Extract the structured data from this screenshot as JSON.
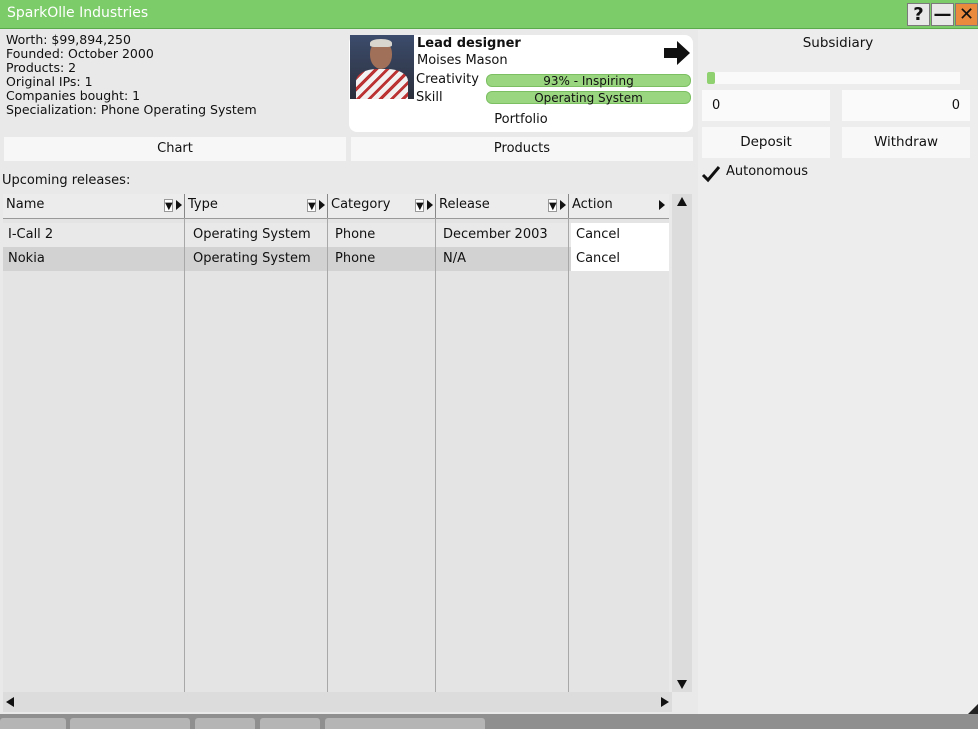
{
  "window": {
    "title": "SparkOlle Industries"
  },
  "titlebar": {
    "help_label": "?",
    "minimize_label": "—",
    "close_label": "✕"
  },
  "company": {
    "worth": "Worth: $99,894,250",
    "founded": "Founded: October 2000",
    "products": "Products: 2",
    "original_ips": "Original IPs: 1",
    "companies_bought": "Companies bought: 1",
    "specialization": "Specialization: Phone Operating System"
  },
  "designer": {
    "role": "Lead designer",
    "name": "Moises Mason",
    "creativity_label": "Creativity",
    "creativity_value": "93% - Inspiring",
    "creativity_fraction": 1.0,
    "skill_label": "Skill",
    "skill_value": "Operating System",
    "portfolio_label": "Portfolio"
  },
  "tabs": {
    "chart_label": "Chart",
    "products_label": "Products"
  },
  "releases": {
    "heading": "Upcoming releases:",
    "columns": [
      "Name",
      "Type",
      "Category",
      "Release",
      "Action"
    ],
    "rows": [
      {
        "name": "I-Call 2",
        "type": "Operating System",
        "category": "Phone",
        "release": "December 2003",
        "action": "Cancel"
      },
      {
        "name": "Nokia",
        "type": "Operating System",
        "category": "Phone",
        "release": "N/A",
        "action": "Cancel"
      }
    ]
  },
  "subsidiary": {
    "title": "Subsidiary",
    "progress_fraction": 0.03,
    "left_value": "0",
    "right_value": "0",
    "deposit_label": "Deposit",
    "withdraw_label": "Withdraw",
    "autonomous_label": "Autonomous",
    "autonomous_checked": true
  },
  "colors": {
    "accent": "#7dcc6a",
    "bar": "#9ad67f",
    "close": "#e98a3d"
  },
  "icons": [
    "help-icon",
    "minimize-icon",
    "close-icon",
    "arrow-right-icon",
    "filter-icon",
    "checkmark-icon"
  ]
}
